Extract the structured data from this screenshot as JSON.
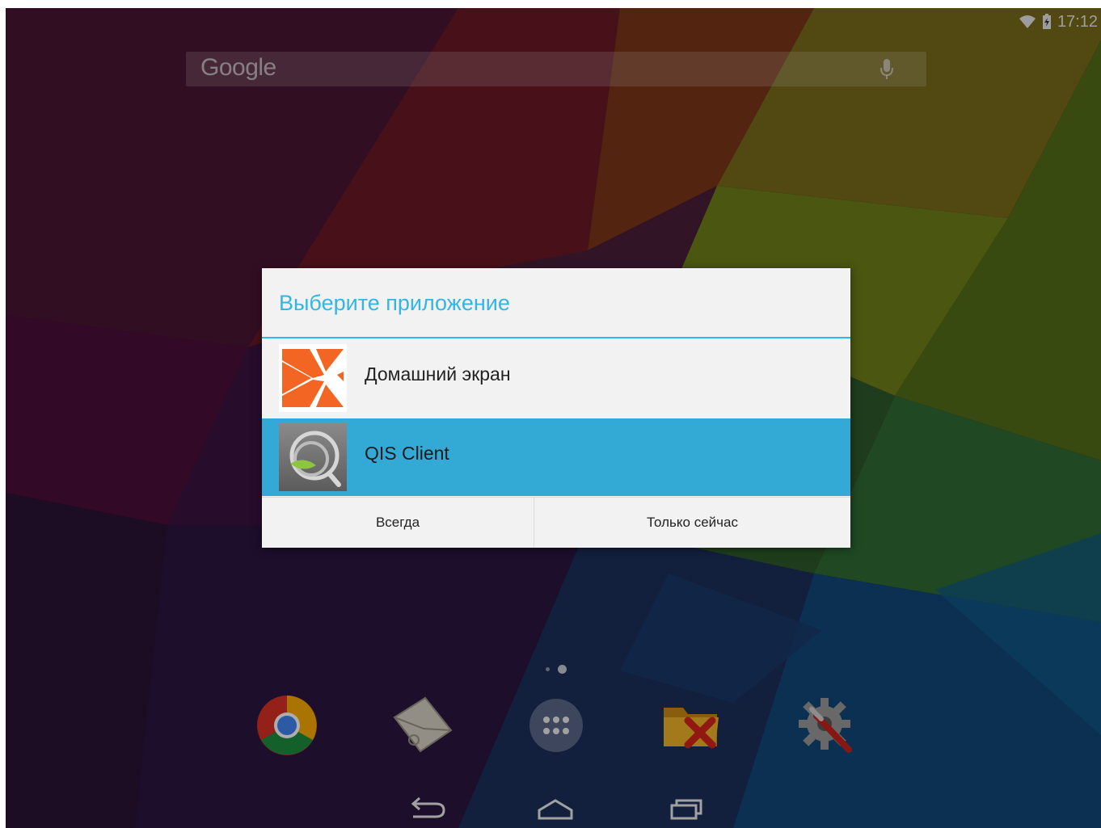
{
  "status_bar": {
    "time": "17:12",
    "wifi_icon": "wifi-icon",
    "battery_icon": "battery-charging-icon"
  },
  "search_bar": {
    "logo_text": "Google",
    "mic_icon": "microphone-icon"
  },
  "dialog": {
    "title": "Выберите приложение",
    "accent_color": "#33b5e5",
    "selected_color": "#33a9d6",
    "apps": [
      {
        "label": "Домашний экран",
        "icon": "home-screen-launcher-icon",
        "selected": false
      },
      {
        "label": "QIS Client",
        "icon": "qis-client-icon",
        "selected": true
      }
    ],
    "buttons": {
      "always": "Всегда",
      "just_once": "Только сейчас"
    }
  },
  "dock": {
    "items": [
      {
        "icon": "chrome-icon"
      },
      {
        "icon": "email-icon"
      },
      {
        "icon": "app-drawer-icon"
      },
      {
        "icon": "file-manager-icon"
      },
      {
        "icon": "settings-icon"
      }
    ]
  },
  "navigation": {
    "back": "back-icon",
    "home": "home-icon",
    "recents": "recent-apps-icon"
  }
}
